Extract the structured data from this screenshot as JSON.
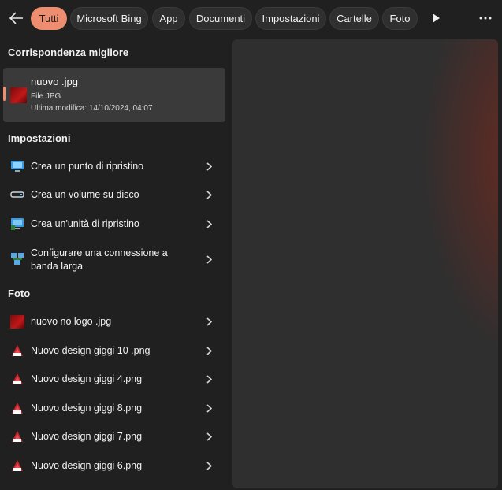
{
  "filters": {
    "back_icon": "back-arrow-icon",
    "items": [
      "Tutti",
      "Microsoft Bing",
      "App",
      "Documenti",
      "Impostazioni",
      "Cartelle",
      "Foto"
    ],
    "active": "Tutti",
    "play_icon": "play-icon",
    "more_icon": "more-icon"
  },
  "best_match": {
    "heading": "Corrispondenza migliore",
    "name": "nuovo .jpg",
    "type": "File JPG",
    "modified": "Ultima modifica: 14/10/2024, 04:07"
  },
  "settings": {
    "heading": "Impostazioni",
    "items": [
      {
        "label": "Crea un punto di ripristino",
        "icon": "system-protection-icon"
      },
      {
        "label": "Crea un volume su disco",
        "icon": "disk-volume-icon"
      },
      {
        "label": "Crea un'unità di ripristino",
        "icon": "recovery-drive-icon"
      },
      {
        "label": "Configurare una connessione a banda larga",
        "icon": "network-connection-icon"
      }
    ]
  },
  "photos": {
    "heading": "Foto",
    "items": [
      {
        "label": "nuovo no logo .jpg",
        "icon": "jpg-thumbnail-icon"
      },
      {
        "label": "Nuovo design giggi 10 .png",
        "icon": "png-thumbnail-icon"
      },
      {
        "label": "Nuovo design giggi 4.png",
        "icon": "png-thumbnail-icon"
      },
      {
        "label": "Nuovo design giggi 8.png",
        "icon": "png-thumbnail-icon"
      },
      {
        "label": "Nuovo design giggi 7.png",
        "icon": "png-thumbnail-icon"
      },
      {
        "label": "Nuovo design giggi 6.png",
        "icon": "png-thumbnail-icon"
      }
    ]
  },
  "colors": {
    "accent": "#ee8d6f",
    "background": "#202020",
    "selected_row": "#3a3a3a"
  }
}
